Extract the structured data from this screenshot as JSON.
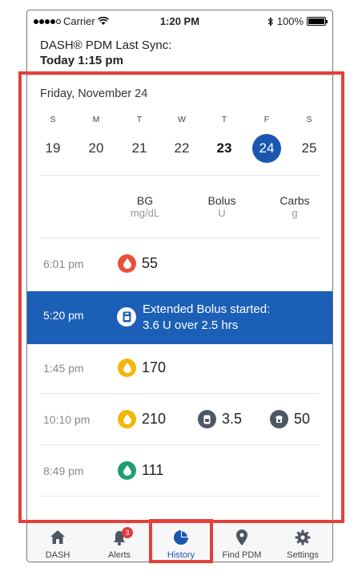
{
  "status_bar": {
    "carrier": "Carrier",
    "time": "1:20 PM",
    "battery": "100%"
  },
  "sync": {
    "line1": "DASH® PDM Last Sync:",
    "line2": "Today 1:15 pm"
  },
  "calendar": {
    "title": "Friday, November 24",
    "days": [
      {
        "letter": "S",
        "num": "19"
      },
      {
        "letter": "M",
        "num": "20"
      },
      {
        "letter": "T",
        "num": "21"
      },
      {
        "letter": "W",
        "num": "22"
      },
      {
        "letter": "T",
        "num": "23"
      },
      {
        "letter": "F",
        "num": "24"
      },
      {
        "letter": "S",
        "num": "25"
      }
    ]
  },
  "columns": {
    "bg": {
      "label": "BG",
      "unit": "mg/dL"
    },
    "bolus": {
      "label": "Bolus",
      "unit": "U"
    },
    "carbs": {
      "label": "Carbs",
      "unit": "g"
    }
  },
  "entries": [
    {
      "time": "6:01 pm",
      "bg": "55",
      "bg_color": "#e8503a"
    },
    {
      "time": "5:20 pm",
      "text_line1": "Extended Bolus started:",
      "text_line2": "3.6 U over 2.5 hrs"
    },
    {
      "time": "1:45 pm",
      "bg": "170",
      "bg_color": "#f2b705"
    },
    {
      "time": "10:10 pm",
      "bg": "210",
      "bg_color": "#f2b705",
      "bolus": "3.5",
      "carbs": "50"
    },
    {
      "time": "8:49 pm",
      "bg": "111",
      "bg_color": "#1f9e6e"
    }
  ],
  "tabs": {
    "dash": "DASH",
    "alerts": "Alerts",
    "alerts_badge": "3",
    "history": "History",
    "find_pdm": "Find PDM",
    "settings": "Settings"
  },
  "colors": {
    "accent": "#1b57b1",
    "highlight": "#e3403a",
    "icon_gray": "#4d5663"
  }
}
